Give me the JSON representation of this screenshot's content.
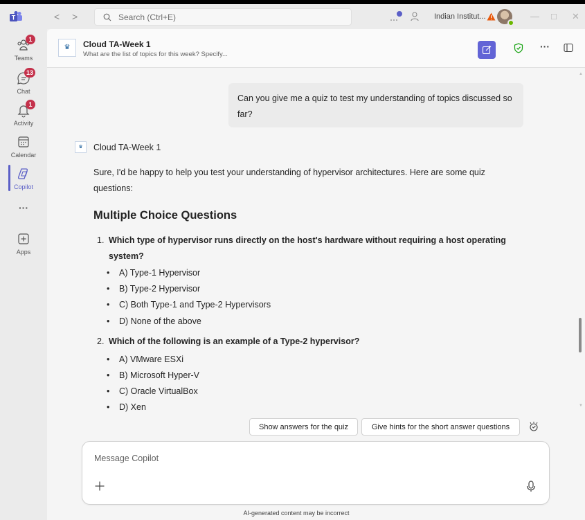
{
  "titlebar": {
    "search_placeholder": "Search (Ctrl+E)",
    "org_name": "Indian Institut...",
    "back_arrow": "<",
    "forward_arrow": ">",
    "minimize": "—",
    "maximize": "□",
    "close": "✕"
  },
  "rail": {
    "items": [
      {
        "label": "Teams",
        "badge": "1"
      },
      {
        "label": "Chat",
        "badge": "13"
      },
      {
        "label": "Activity",
        "badge": "1"
      },
      {
        "label": "Calendar"
      },
      {
        "label": "Copilot"
      },
      {
        "label": "···"
      },
      {
        "label": "Apps"
      }
    ]
  },
  "header": {
    "title": "Cloud TA-Week 1",
    "subtitle": "What are the list of topics for this week? Specify...",
    "more": "···"
  },
  "conversation": {
    "user_message": "Can you give me a quiz to test my understanding of topics discussed so far?",
    "bot_name": "Cloud TA-Week 1",
    "bot_intro": "Sure, I'd be happy to help you test your understanding of hypervisor architectures. Here are some quiz questions:",
    "section_heading": "Multiple Choice Questions",
    "questions": [
      {
        "num": "1.",
        "text": "Which type of hypervisor runs directly on the host's hardware without requiring a host operating system?",
        "options": [
          "A) Type-1 Hypervisor",
          "B) Type-2 Hypervisor",
          "C) Both Type-1 and Type-2 Hypervisors",
          "D) None of the above"
        ]
      },
      {
        "num": "2.",
        "text": "Which of the following is an example of a Type-2 hypervisor?",
        "options": [
          "A) VMware ESXi",
          "B) Microsoft Hyper-V",
          "C) Oracle VirtualBox",
          "D) Xen"
        ]
      }
    ]
  },
  "suggestions": [
    "Show answers for the quiz",
    "Give hints for the short answer questions"
  ],
  "composer": {
    "placeholder": "Message Copilot",
    "plus": "+"
  },
  "disclaimer": "AI-generated content may be incorrect",
  "colors": {
    "accent": "#5b5fc7",
    "badge": "#c4314b",
    "presence": "#6bb700",
    "primary_button": "#6264d6"
  },
  "icons": {
    "rail": [
      "teams-icon",
      "chat-icon",
      "activity-icon",
      "calendar-icon",
      "copilot-icon",
      "more-icon",
      "apps-icon"
    ],
    "header": [
      "new-chat-icon",
      "shield-check-icon",
      "more-icon",
      "side-panel-icon"
    ],
    "composer": [
      "plus-icon",
      "microphone-icon"
    ]
  }
}
